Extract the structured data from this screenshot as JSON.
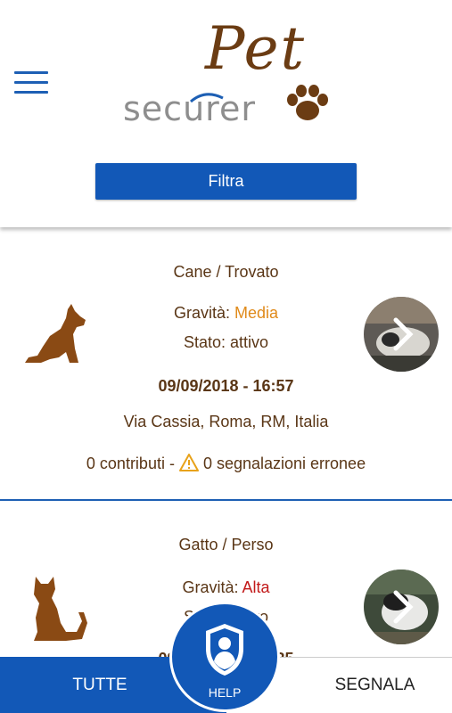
{
  "header": {
    "logo_word_top": "Pet",
    "logo_word_bottom": "securer",
    "filter_label": "Filtra"
  },
  "reports": [
    {
      "type_status": "Cane / Trovato",
      "gravity_label": "Gravità: ",
      "gravity_value": "Media",
      "state": "Stato: attivo",
      "datetime": "09/09/2018 - 16:57",
      "address": "Via Cassia, Roma, RM, Italia",
      "contributions": "0 contributi - ",
      "wrong_reports": " 0 segnalazioni erronee"
    },
    {
      "type_status": "Gatto / Perso",
      "gravity_label": "Gravità: ",
      "gravity_value": "Alta",
      "state": "Stato: attivo",
      "datetime": "09/09/2018 - 16:35"
    }
  ],
  "bottom_nav": {
    "all_label": "TUTTE",
    "report_label": "SEGNALA",
    "help_label": "HELP"
  },
  "colors": {
    "primary": "#1258b7",
    "brown": "#6b3c13",
    "medium": "#e08a1a",
    "high": "#c21a1a"
  }
}
